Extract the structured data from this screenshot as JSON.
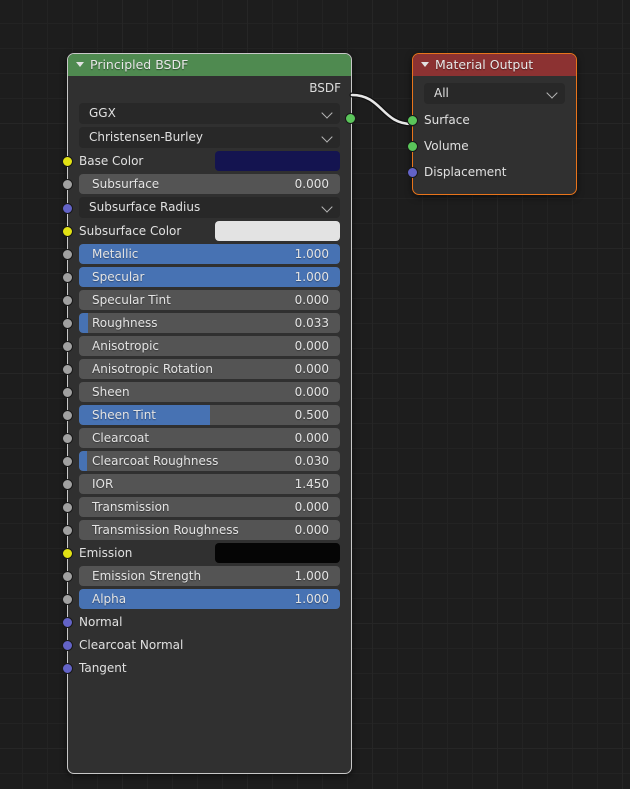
{
  "editor": {
    "name": "Shader Node Editor",
    "background_color": "#1d1d1d",
    "grid_color": "#262626"
  },
  "nodes": {
    "principled": {
      "title": "Principled BSDF",
      "header_color": "#4f8a50",
      "selected": true,
      "outputs": [
        {
          "name": "BSDF",
          "socket_color": "#5ac55a"
        }
      ],
      "enum_distribution": "GGX",
      "enum_subsurface_method": "Christensen-Burley",
      "rows": [
        {
          "label": "Base Color",
          "kind": "color",
          "color": "#141450",
          "socket": "yellow"
        },
        {
          "label": "Subsurface",
          "kind": "slider",
          "value": "0.000",
          "fill": 0,
          "socket": "gray"
        },
        {
          "label": "Subsurface Radius",
          "kind": "enum",
          "value": "",
          "socket": "purple"
        },
        {
          "label": "Subsurface Color",
          "kind": "color",
          "color": "#e3e3e3",
          "socket": "yellow"
        },
        {
          "label": "Metallic",
          "kind": "slider",
          "value": "1.000",
          "fill": 100,
          "socket": "gray"
        },
        {
          "label": "Specular",
          "kind": "slider",
          "value": "1.000",
          "fill": 100,
          "socket": "gray"
        },
        {
          "label": "Specular Tint",
          "kind": "slider",
          "value": "0.000",
          "fill": 0,
          "socket": "gray"
        },
        {
          "label": "Roughness",
          "kind": "slider",
          "value": "0.033",
          "fill": 3.3,
          "socket": "gray"
        },
        {
          "label": "Anisotropic",
          "kind": "slider",
          "value": "0.000",
          "fill": 0,
          "socket": "gray"
        },
        {
          "label": "Anisotropic Rotation",
          "kind": "slider",
          "value": "0.000",
          "fill": 0,
          "socket": "gray"
        },
        {
          "label": "Sheen",
          "kind": "slider",
          "value": "0.000",
          "fill": 0,
          "socket": "gray"
        },
        {
          "label": "Sheen Tint",
          "kind": "slider",
          "value": "0.500",
          "fill": 50,
          "socket": "gray"
        },
        {
          "label": "Clearcoat",
          "kind": "slider",
          "value": "0.000",
          "fill": 0,
          "socket": "gray"
        },
        {
          "label": "Clearcoat Roughness",
          "kind": "slider",
          "value": "0.030",
          "fill": 3,
          "socket": "gray"
        },
        {
          "label": "IOR",
          "kind": "number",
          "value": "1.450",
          "fill": 0,
          "socket": "gray"
        },
        {
          "label": "Transmission",
          "kind": "slider",
          "value": "0.000",
          "fill": 0,
          "socket": "gray"
        },
        {
          "label": "Transmission Roughness",
          "kind": "slider",
          "value": "0.000",
          "fill": 0,
          "socket": "gray"
        },
        {
          "label": "Emission",
          "kind": "color",
          "color": "#050505",
          "socket": "yellow"
        },
        {
          "label": "Emission Strength",
          "kind": "number",
          "value": "1.000",
          "fill": 0,
          "socket": "gray"
        },
        {
          "label": "Alpha",
          "kind": "slider",
          "value": "1.000",
          "fill": 100,
          "socket": "gray"
        },
        {
          "label": "Normal",
          "kind": "name",
          "value": "",
          "socket": "purple"
        },
        {
          "label": "Clearcoat Normal",
          "kind": "name",
          "value": "",
          "socket": "purple"
        },
        {
          "label": "Tangent",
          "kind": "name",
          "value": "",
          "socket": "purple"
        }
      ]
    },
    "material_output": {
      "title": "Material Output",
      "header_color": "#8c3232",
      "active": true,
      "border_color": "#e8741b",
      "enum_target": "All",
      "inputs": [
        {
          "label": "Surface",
          "socket": "green"
        },
        {
          "label": "Volume",
          "socket": "green"
        },
        {
          "label": "Displacement",
          "socket": "purple"
        }
      ]
    }
  },
  "link": {
    "from": "BSDF",
    "to": "Surface",
    "color": "#e6e6e6"
  }
}
